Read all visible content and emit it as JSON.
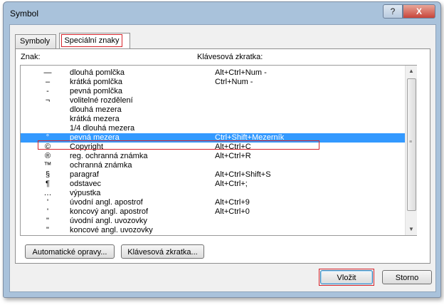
{
  "window": {
    "title": "Symbol",
    "help_label": "?",
    "close_label": "X"
  },
  "tabs": [
    {
      "label": "Symboly"
    },
    {
      "label": "Speciální znaky"
    }
  ],
  "list": {
    "header_char": "Znak:",
    "header_shortcut": "Klávesová zkratka:",
    "selected_index": 7,
    "rows": [
      {
        "symbol": "—",
        "name": "dlouhá pomlčka",
        "shortcut": "Alt+Ctrl+Num -"
      },
      {
        "symbol": "–",
        "name": "krátká pomlčka",
        "shortcut": "Ctrl+Num -"
      },
      {
        "symbol": "-",
        "name": "pevná pomlčka",
        "shortcut": ""
      },
      {
        "symbol": "¬",
        "name": "volitelné rozdělení",
        "shortcut": ""
      },
      {
        "symbol": "",
        "name": "dlouhá mezera",
        "shortcut": ""
      },
      {
        "symbol": "",
        "name": "krátká mezera",
        "shortcut": ""
      },
      {
        "symbol": "",
        "name": "1/4 dlouhá mezera",
        "shortcut": ""
      },
      {
        "symbol": "°",
        "name": "pevná mezera",
        "shortcut": "Ctrl+Shift+Mezerník"
      },
      {
        "symbol": "©",
        "name": "Copyright",
        "shortcut": "Alt+Ctrl+C"
      },
      {
        "symbol": "®",
        "name": "reg. ochranná známka",
        "shortcut": "Alt+Ctrl+R"
      },
      {
        "symbol": "™",
        "name": "ochranná známka",
        "shortcut": ""
      },
      {
        "symbol": "§",
        "name": "paragraf",
        "shortcut": "Alt+Ctrl+Shift+S"
      },
      {
        "symbol": "¶",
        "name": "odstavec",
        "shortcut": "Alt+Ctrl+;"
      },
      {
        "symbol": "…",
        "name": "výpustka",
        "shortcut": ""
      },
      {
        "symbol": "'",
        "name": "úvodní angl. apostrof",
        "shortcut": "Alt+Ctrl+9"
      },
      {
        "symbol": "'",
        "name": "koncový angl. apostrof",
        "shortcut": "Alt+Ctrl+0"
      },
      {
        "symbol": "\"",
        "name": "úvodní angl. uvozovky",
        "shortcut": ""
      },
      {
        "symbol": "\"",
        "name": "koncové angl. uvozovky",
        "shortcut": ""
      }
    ]
  },
  "buttons": {
    "autocorrect": "Automatické opravy...",
    "shortcut_key": "Klávesová zkratka...",
    "insert": "Vložit",
    "cancel": "Storno"
  },
  "colors": {
    "selection": "#3399ff",
    "highlight_outline": "#d6232a"
  },
  "icons": {
    "scroll_up": "▲",
    "scroll_down": "▼",
    "grip": "≡"
  }
}
